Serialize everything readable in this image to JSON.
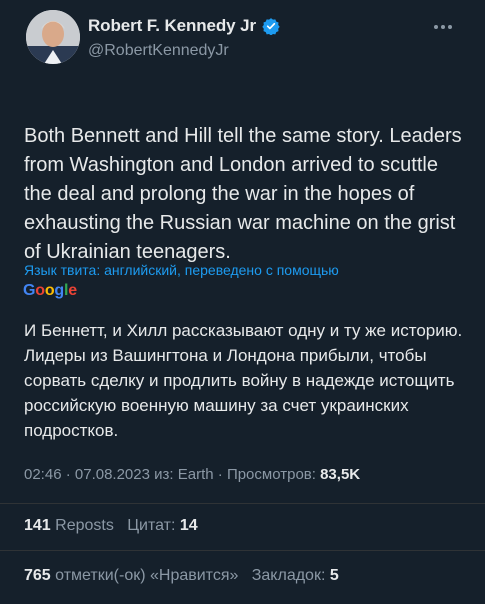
{
  "author": {
    "name": "Robert F. Kennedy Jr",
    "handle": "@RobertKennedyJr"
  },
  "tweet": {
    "text": "Both Bennett and Hill tell the same story. Leaders from Washington and London arrived to scuttle the deal and prolong the war in the hopes of exhausting the Russian war machine on the grist of Ukrainian teenagers."
  },
  "translation": {
    "label": "Язык твита: английский, переведено с помощью",
    "provider": "Google",
    "text": "И Беннетт, и Хилл рассказывают одну и ту же историю. Лидеры из Вашингтона и Лондона прибыли, чтобы сорвать сделку и продлить войну в надежде истощить российскую военную машину за счет украинских подростков."
  },
  "meta": {
    "time": "02:46",
    "date": "07.08.2023",
    "source": "из: Earth",
    "views_label": "Просмотров:",
    "views_count": "83,5K"
  },
  "stats": {
    "reposts_count": "141",
    "reposts_label": "Reposts",
    "quotes_label": "Цитат:",
    "quotes_count": "14",
    "likes_count": "765",
    "likes_label": "отметки(-ок) «Нравится»",
    "bookmarks_label": "Закладок:",
    "bookmarks_count": "5"
  },
  "colors": {
    "background": "#15202b",
    "link": "#1d9bf0",
    "muted": "#8b98a5",
    "text": "#e7e9ea"
  }
}
